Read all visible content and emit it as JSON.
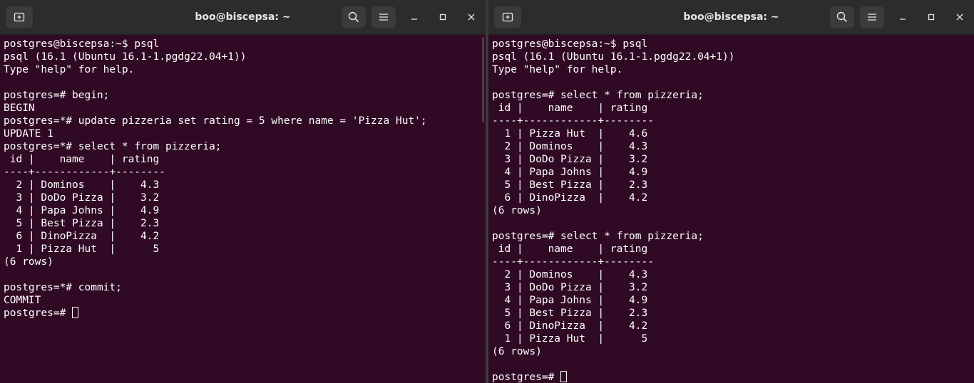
{
  "colors": {
    "terminal_bg": "#300a24",
    "titlebar_bg": "#2c2c2c",
    "text": "#ffffff"
  },
  "icons": {
    "new_tab": "new-tab-icon",
    "search": "search-icon",
    "menu": "hamburger-menu-icon",
    "minimize": "minimize-icon",
    "maximize": "maximize-icon",
    "close": "close-icon"
  },
  "left": {
    "title": "boo@biscepsa: ~",
    "lines": [
      "postgres@biscepsa:~$ psql",
      "psql (16.1 (Ubuntu 16.1-1.pgdg22.04+1))",
      "Type \"help\" for help.",
      "",
      "postgres=# begin;",
      "BEGIN",
      "postgres=*# update pizzeria set rating = 5 where name = 'Pizza Hut';",
      "UPDATE 1",
      "postgres=*# select * from pizzeria;",
      " id |    name    | rating ",
      "----+------------+--------",
      "  2 | Dominos    |    4.3",
      "  3 | DoDo Pizza |    3.2",
      "  4 | Papa Johns |    4.9",
      "  5 | Best Pizza |    2.3",
      "  6 | DinoPizza  |    4.2",
      "  1 | Pizza Hut  |      5",
      "(6 rows)",
      "",
      "postgres=*# commit;",
      "COMMIT"
    ],
    "prompt": "postgres=# "
  },
  "right": {
    "title": "boo@biscepsa: ~",
    "lines": [
      "postgres@biscepsa:~$ psql",
      "psql (16.1 (Ubuntu 16.1-1.pgdg22.04+1))",
      "Type \"help\" for help.",
      "",
      "postgres=# select * from pizzeria;",
      " id |    name    | rating ",
      "----+------------+--------",
      "  1 | Pizza Hut  |    4.6",
      "  2 | Dominos    |    4.3",
      "  3 | DoDo Pizza |    3.2",
      "  4 | Papa Johns |    4.9",
      "  5 | Best Pizza |    2.3",
      "  6 | DinoPizza  |    4.2",
      "(6 rows)",
      "",
      "postgres=# select * from pizzeria;",
      " id |    name    | rating ",
      "----+------------+--------",
      "  2 | Dominos    |    4.3",
      "  3 | DoDo Pizza |    3.2",
      "  4 | Papa Johns |    4.9",
      "  5 | Best Pizza |    2.3",
      "  6 | DinoPizza  |    4.2",
      "  1 | Pizza Hut  |      5",
      "(6 rows)",
      ""
    ],
    "prompt": "postgres=# "
  }
}
